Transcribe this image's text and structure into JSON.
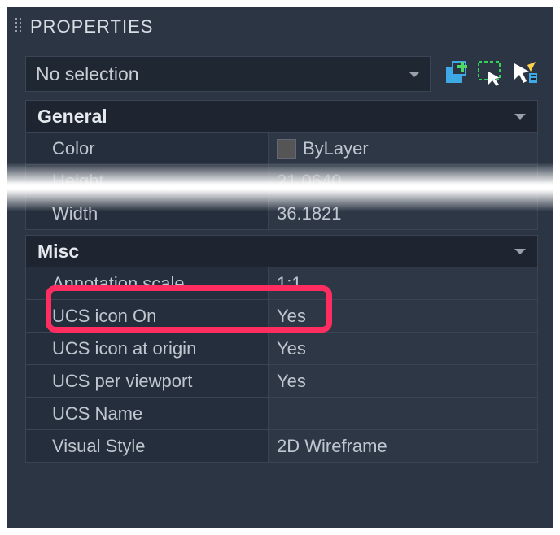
{
  "panel": {
    "title": "PROPERTIES"
  },
  "toolbar": {
    "selection_label": "No selection"
  },
  "groups": {
    "general": {
      "title": "General",
      "rows": {
        "color": {
          "label": "Color",
          "value": "ByLayer"
        },
        "height": {
          "label": "Height",
          "value": "21.0640"
        },
        "width": {
          "label": "Width",
          "value": "36.1821"
        }
      }
    },
    "misc": {
      "title": "Misc",
      "rows": {
        "anno": {
          "label": "Annotation scale",
          "value": "1:1"
        },
        "ucs_on": {
          "label": "UCS icon On",
          "value": "Yes"
        },
        "ucs_origin": {
          "label": "UCS icon at origin",
          "value": "Yes"
        },
        "ucs_vp": {
          "label": "UCS per viewport",
          "value": "Yes"
        },
        "ucs_name": {
          "label": "UCS Name",
          "value": ""
        },
        "vstyle": {
          "label": "Visual Style",
          "value": "2D Wireframe"
        }
      }
    }
  }
}
